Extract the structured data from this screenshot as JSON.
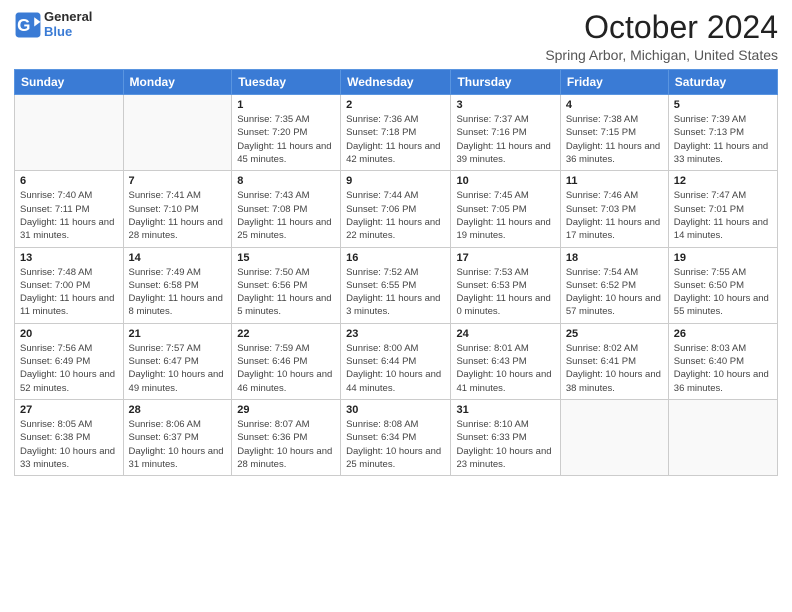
{
  "logo": {
    "text_general": "General",
    "text_blue": "Blue"
  },
  "title": "October 2024",
  "location": "Spring Arbor, Michigan, United States",
  "days_of_week": [
    "Sunday",
    "Monday",
    "Tuesday",
    "Wednesday",
    "Thursday",
    "Friday",
    "Saturday"
  ],
  "weeks": [
    [
      {
        "day": "",
        "sunrise": "",
        "sunset": "",
        "daylight": ""
      },
      {
        "day": "",
        "sunrise": "",
        "sunset": "",
        "daylight": ""
      },
      {
        "day": "1",
        "sunrise": "Sunrise: 7:35 AM",
        "sunset": "Sunset: 7:20 PM",
        "daylight": "Daylight: 11 hours and 45 minutes."
      },
      {
        "day": "2",
        "sunrise": "Sunrise: 7:36 AM",
        "sunset": "Sunset: 7:18 PM",
        "daylight": "Daylight: 11 hours and 42 minutes."
      },
      {
        "day": "3",
        "sunrise": "Sunrise: 7:37 AM",
        "sunset": "Sunset: 7:16 PM",
        "daylight": "Daylight: 11 hours and 39 minutes."
      },
      {
        "day": "4",
        "sunrise": "Sunrise: 7:38 AM",
        "sunset": "Sunset: 7:15 PM",
        "daylight": "Daylight: 11 hours and 36 minutes."
      },
      {
        "day": "5",
        "sunrise": "Sunrise: 7:39 AM",
        "sunset": "Sunset: 7:13 PM",
        "daylight": "Daylight: 11 hours and 33 minutes."
      }
    ],
    [
      {
        "day": "6",
        "sunrise": "Sunrise: 7:40 AM",
        "sunset": "Sunset: 7:11 PM",
        "daylight": "Daylight: 11 hours and 31 minutes."
      },
      {
        "day": "7",
        "sunrise": "Sunrise: 7:41 AM",
        "sunset": "Sunset: 7:10 PM",
        "daylight": "Daylight: 11 hours and 28 minutes."
      },
      {
        "day": "8",
        "sunrise": "Sunrise: 7:43 AM",
        "sunset": "Sunset: 7:08 PM",
        "daylight": "Daylight: 11 hours and 25 minutes."
      },
      {
        "day": "9",
        "sunrise": "Sunrise: 7:44 AM",
        "sunset": "Sunset: 7:06 PM",
        "daylight": "Daylight: 11 hours and 22 minutes."
      },
      {
        "day": "10",
        "sunrise": "Sunrise: 7:45 AM",
        "sunset": "Sunset: 7:05 PM",
        "daylight": "Daylight: 11 hours and 19 minutes."
      },
      {
        "day": "11",
        "sunrise": "Sunrise: 7:46 AM",
        "sunset": "Sunset: 7:03 PM",
        "daylight": "Daylight: 11 hours and 17 minutes."
      },
      {
        "day": "12",
        "sunrise": "Sunrise: 7:47 AM",
        "sunset": "Sunset: 7:01 PM",
        "daylight": "Daylight: 11 hours and 14 minutes."
      }
    ],
    [
      {
        "day": "13",
        "sunrise": "Sunrise: 7:48 AM",
        "sunset": "Sunset: 7:00 PM",
        "daylight": "Daylight: 11 hours and 11 minutes."
      },
      {
        "day": "14",
        "sunrise": "Sunrise: 7:49 AM",
        "sunset": "Sunset: 6:58 PM",
        "daylight": "Daylight: 11 hours and 8 minutes."
      },
      {
        "day": "15",
        "sunrise": "Sunrise: 7:50 AM",
        "sunset": "Sunset: 6:56 PM",
        "daylight": "Daylight: 11 hours and 5 minutes."
      },
      {
        "day": "16",
        "sunrise": "Sunrise: 7:52 AM",
        "sunset": "Sunset: 6:55 PM",
        "daylight": "Daylight: 11 hours and 3 minutes."
      },
      {
        "day": "17",
        "sunrise": "Sunrise: 7:53 AM",
        "sunset": "Sunset: 6:53 PM",
        "daylight": "Daylight: 11 hours and 0 minutes."
      },
      {
        "day": "18",
        "sunrise": "Sunrise: 7:54 AM",
        "sunset": "Sunset: 6:52 PM",
        "daylight": "Daylight: 10 hours and 57 minutes."
      },
      {
        "day": "19",
        "sunrise": "Sunrise: 7:55 AM",
        "sunset": "Sunset: 6:50 PM",
        "daylight": "Daylight: 10 hours and 55 minutes."
      }
    ],
    [
      {
        "day": "20",
        "sunrise": "Sunrise: 7:56 AM",
        "sunset": "Sunset: 6:49 PM",
        "daylight": "Daylight: 10 hours and 52 minutes."
      },
      {
        "day": "21",
        "sunrise": "Sunrise: 7:57 AM",
        "sunset": "Sunset: 6:47 PM",
        "daylight": "Daylight: 10 hours and 49 minutes."
      },
      {
        "day": "22",
        "sunrise": "Sunrise: 7:59 AM",
        "sunset": "Sunset: 6:46 PM",
        "daylight": "Daylight: 10 hours and 46 minutes."
      },
      {
        "day": "23",
        "sunrise": "Sunrise: 8:00 AM",
        "sunset": "Sunset: 6:44 PM",
        "daylight": "Daylight: 10 hours and 44 minutes."
      },
      {
        "day": "24",
        "sunrise": "Sunrise: 8:01 AM",
        "sunset": "Sunset: 6:43 PM",
        "daylight": "Daylight: 10 hours and 41 minutes."
      },
      {
        "day": "25",
        "sunrise": "Sunrise: 8:02 AM",
        "sunset": "Sunset: 6:41 PM",
        "daylight": "Daylight: 10 hours and 38 minutes."
      },
      {
        "day": "26",
        "sunrise": "Sunrise: 8:03 AM",
        "sunset": "Sunset: 6:40 PM",
        "daylight": "Daylight: 10 hours and 36 minutes."
      }
    ],
    [
      {
        "day": "27",
        "sunrise": "Sunrise: 8:05 AM",
        "sunset": "Sunset: 6:38 PM",
        "daylight": "Daylight: 10 hours and 33 minutes."
      },
      {
        "day": "28",
        "sunrise": "Sunrise: 8:06 AM",
        "sunset": "Sunset: 6:37 PM",
        "daylight": "Daylight: 10 hours and 31 minutes."
      },
      {
        "day": "29",
        "sunrise": "Sunrise: 8:07 AM",
        "sunset": "Sunset: 6:36 PM",
        "daylight": "Daylight: 10 hours and 28 minutes."
      },
      {
        "day": "30",
        "sunrise": "Sunrise: 8:08 AM",
        "sunset": "Sunset: 6:34 PM",
        "daylight": "Daylight: 10 hours and 25 minutes."
      },
      {
        "day": "31",
        "sunrise": "Sunrise: 8:10 AM",
        "sunset": "Sunset: 6:33 PM",
        "daylight": "Daylight: 10 hours and 23 minutes."
      },
      {
        "day": "",
        "sunrise": "",
        "sunset": "",
        "daylight": ""
      },
      {
        "day": "",
        "sunrise": "",
        "sunset": "",
        "daylight": ""
      }
    ]
  ]
}
